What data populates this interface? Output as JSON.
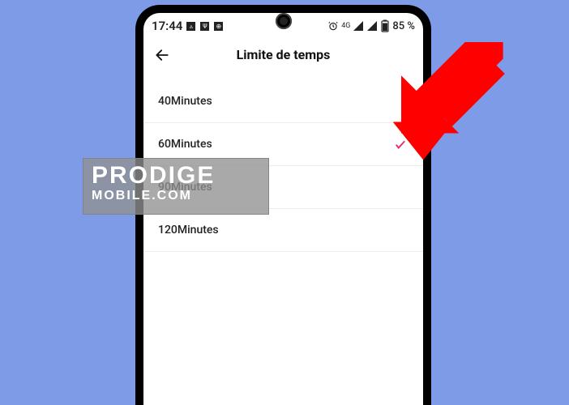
{
  "statusbar": {
    "time": "17:44",
    "network_label": "4G",
    "battery_text": "85 %"
  },
  "header": {
    "title": "Limite de temps"
  },
  "options": [
    {
      "label": "40Minutes",
      "selected": false
    },
    {
      "label": "60Minutes",
      "selected": true
    },
    {
      "label": "90Minutes",
      "selected": false
    },
    {
      "label": "120Minutes",
      "selected": false
    }
  ],
  "watermark": {
    "line1": "PRODIGE",
    "line2": "MOBILE.COM"
  }
}
